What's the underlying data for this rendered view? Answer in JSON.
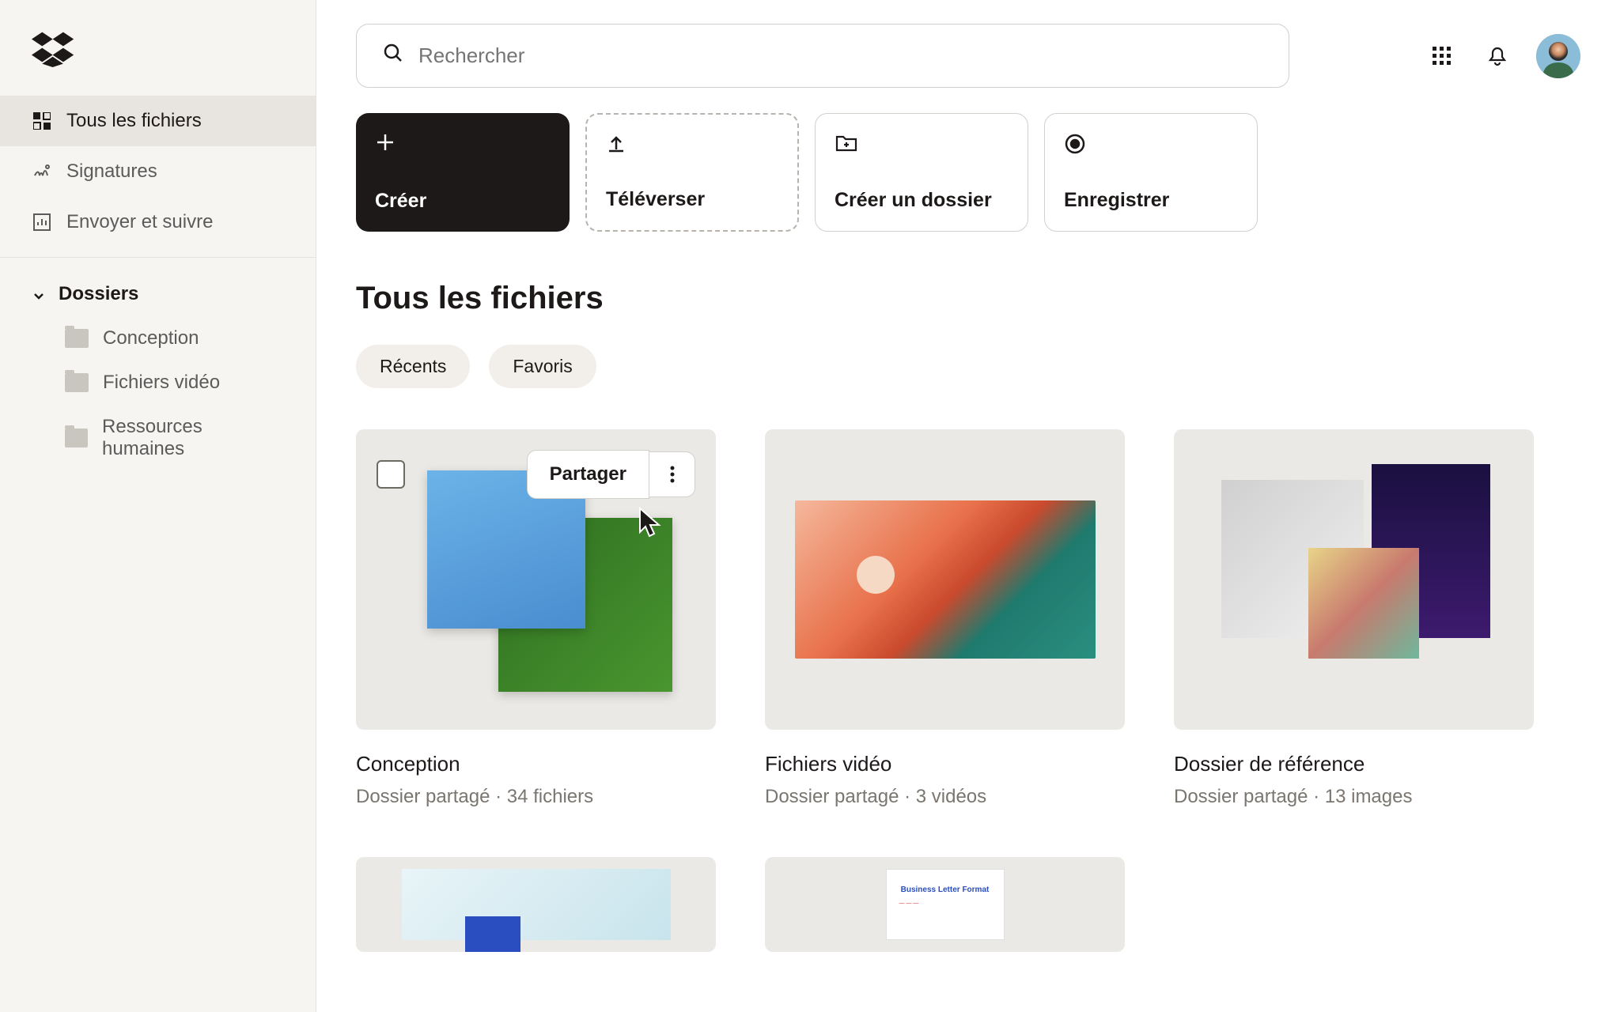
{
  "sidebar": {
    "nav": [
      {
        "label": "Tous les fichiers"
      },
      {
        "label": "Signatures"
      },
      {
        "label": "Envoyer et suivre"
      }
    ],
    "folders_header": "Dossiers",
    "folders": [
      {
        "label": "Conception"
      },
      {
        "label": "Fichiers vidéo"
      },
      {
        "label": "Ressources humaines"
      }
    ]
  },
  "search": {
    "placeholder": "Rechercher"
  },
  "actions": {
    "create": "Créer",
    "upload": "Téléverser",
    "create_folder": "Créer un dossier",
    "record": "Enregistrer"
  },
  "page_title": "Tous les fichiers",
  "chips": {
    "recent": "Récents",
    "favorites": "Favoris"
  },
  "hover": {
    "share": "Partager"
  },
  "cards": [
    {
      "title": "Conception",
      "meta": "Dossier partagé · 34 fichiers"
    },
    {
      "title": "Fichiers vidéo",
      "meta": "Dossier partagé · 3 vidéos"
    },
    {
      "title": "Dossier de référence",
      "meta": "Dossier partagé · 13 images"
    },
    {
      "title": "",
      "meta": ""
    },
    {
      "title": "",
      "meta": ""
    }
  ],
  "doc_preview": {
    "heading": "Business Letter Format"
  }
}
